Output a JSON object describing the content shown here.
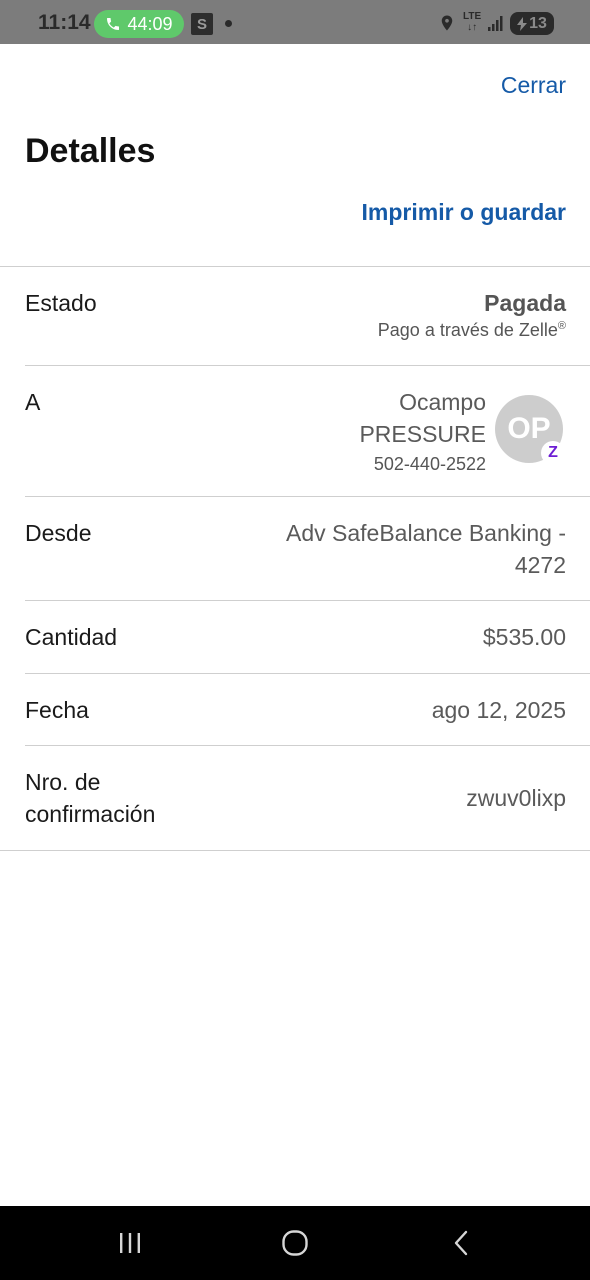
{
  "status_bar": {
    "time": "11:14",
    "call_timer": "44:09",
    "app_letter": "S",
    "network": "LTE",
    "battery": "13",
    "call_color": "#5fc96b"
  },
  "header": {
    "close_label": "Cerrar",
    "title": "Detalles",
    "print_label": "Imprimir o guardar",
    "accent_color": "#155aa7"
  },
  "details": {
    "status": {
      "label": "Estado",
      "value": "Pagada",
      "sub": "Pago a través de Zelle",
      "sub_mark": "®"
    },
    "recipient": {
      "label": "A",
      "name_line1": "Ocampo",
      "name_line2": "PRESSURE",
      "phone": "502-440-2522",
      "avatar_initials": "OP",
      "badge_icon": "zelle-icon",
      "badge_letter": "Z"
    },
    "from": {
      "label": "Desde",
      "value_line1": "Adv SafeBalance Banking -",
      "value_line2": "4272"
    },
    "amount": {
      "label": "Cantidad",
      "value": "$535.00"
    },
    "date": {
      "label": "Fecha",
      "value": "ago 12, 2025"
    },
    "confirmation": {
      "label_line1": "Nro. de",
      "label_line2": "confirmación",
      "value": "zwuv0lixp"
    }
  },
  "nav_bar": {
    "recent_icon": "recent-apps-icon",
    "home_icon": "home-icon",
    "back_icon": "back-icon"
  }
}
